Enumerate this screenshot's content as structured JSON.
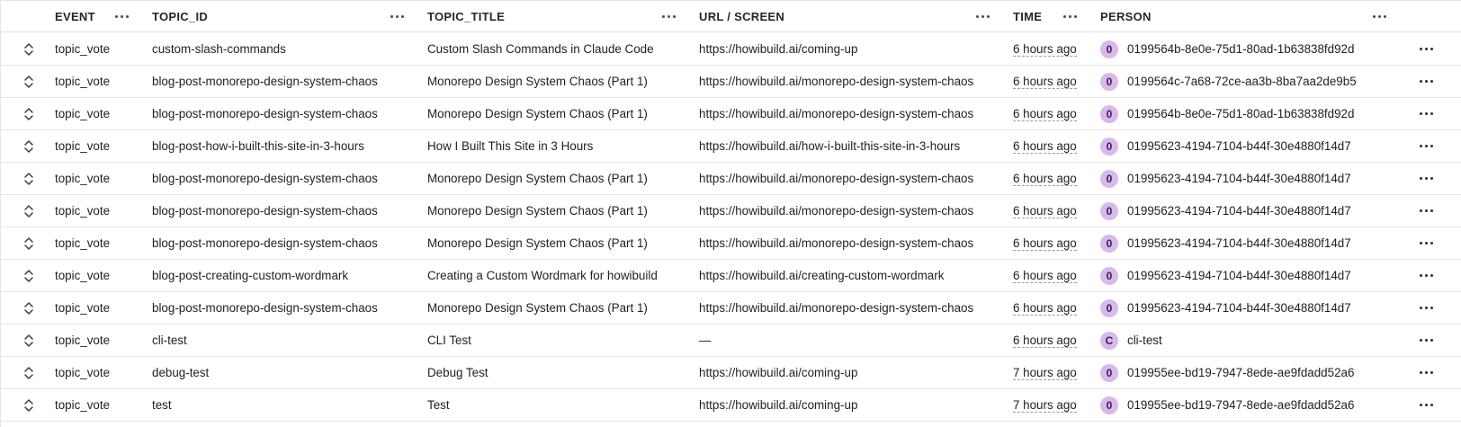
{
  "header": {
    "event": "EVENT",
    "topic_id": "TOPIC_ID",
    "topic_title": "TOPIC_TITLE",
    "url": "URL / SCREEN",
    "time": "TIME",
    "person": "PERSON"
  },
  "rows": [
    {
      "event": "topic_vote",
      "topic_id": "custom-slash-commands",
      "topic_title": "Custom Slash Commands in Claude Code",
      "url": "https://howibuild.ai/coming-up",
      "time": "6 hours ago",
      "avatar": "0",
      "person": "0199564b-8e0e-75d1-80ad-1b63838fd92d"
    },
    {
      "event": "topic_vote",
      "topic_id": "blog-post-monorepo-design-system-chaos",
      "topic_title": "Monorepo Design System Chaos (Part 1)",
      "url": "https://howibuild.ai/monorepo-design-system-chaos",
      "time": "6 hours ago",
      "avatar": "0",
      "person": "0199564c-7a68-72ce-aa3b-8ba7aa2de9b5"
    },
    {
      "event": "topic_vote",
      "topic_id": "blog-post-monorepo-design-system-chaos",
      "topic_title": "Monorepo Design System Chaos (Part 1)",
      "url": "https://howibuild.ai/monorepo-design-system-chaos",
      "time": "6 hours ago",
      "avatar": "0",
      "person": "0199564b-8e0e-75d1-80ad-1b63838fd92d"
    },
    {
      "event": "topic_vote",
      "topic_id": "blog-post-how-i-built-this-site-in-3-hours",
      "topic_title": "How I Built This Site in 3 Hours",
      "url": "https://howibuild.ai/how-i-built-this-site-in-3-hours",
      "time": "6 hours ago",
      "avatar": "0",
      "person": "01995623-4194-7104-b44f-30e4880f14d7"
    },
    {
      "event": "topic_vote",
      "topic_id": "blog-post-monorepo-design-system-chaos",
      "topic_title": "Monorepo Design System Chaos (Part 1)",
      "url": "https://howibuild.ai/monorepo-design-system-chaos",
      "time": "6 hours ago",
      "avatar": "0",
      "person": "01995623-4194-7104-b44f-30e4880f14d7"
    },
    {
      "event": "topic_vote",
      "topic_id": "blog-post-monorepo-design-system-chaos",
      "topic_title": "Monorepo Design System Chaos (Part 1)",
      "url": "https://howibuild.ai/monorepo-design-system-chaos",
      "time": "6 hours ago",
      "avatar": "0",
      "person": "01995623-4194-7104-b44f-30e4880f14d7"
    },
    {
      "event": "topic_vote",
      "topic_id": "blog-post-monorepo-design-system-chaos",
      "topic_title": "Monorepo Design System Chaos (Part 1)",
      "url": "https://howibuild.ai/monorepo-design-system-chaos",
      "time": "6 hours ago",
      "avatar": "0",
      "person": "01995623-4194-7104-b44f-30e4880f14d7"
    },
    {
      "event": "topic_vote",
      "topic_id": "blog-post-creating-custom-wordmark",
      "topic_title": "Creating a Custom Wordmark for howibuild",
      "url": "https://howibuild.ai/creating-custom-wordmark",
      "time": "6 hours ago",
      "avatar": "0",
      "person": "01995623-4194-7104-b44f-30e4880f14d7"
    },
    {
      "event": "topic_vote",
      "topic_id": "blog-post-monorepo-design-system-chaos",
      "topic_title": "Monorepo Design System Chaos (Part 1)",
      "url": "https://howibuild.ai/monorepo-design-system-chaos",
      "time": "6 hours ago",
      "avatar": "0",
      "person": "01995623-4194-7104-b44f-30e4880f14d7"
    },
    {
      "event": "topic_vote",
      "topic_id": "cli-test",
      "topic_title": "CLI Test",
      "url": "—",
      "time": "6 hours ago",
      "avatar": "C",
      "person": "cli-test"
    },
    {
      "event": "topic_vote",
      "topic_id": "debug-test",
      "topic_title": "Debug Test",
      "url": "https://howibuild.ai/coming-up",
      "time": "7 hours ago",
      "avatar": "0",
      "person": "019955ee-bd19-7947-8ede-ae9fdadd52a6"
    },
    {
      "event": "topic_vote",
      "topic_id": "test",
      "topic_title": "Test",
      "url": "https://howibuild.ai/coming-up",
      "time": "7 hours ago",
      "avatar": "0",
      "person": "019955ee-bd19-7947-8ede-ae9fdadd52a6"
    }
  ],
  "icons": {
    "expand": "expand-collapse-icon",
    "more": "more-horizontal-icon"
  },
  "colors": {
    "avatar_bg": "#d9b8ec",
    "border": "#e6e5df"
  }
}
